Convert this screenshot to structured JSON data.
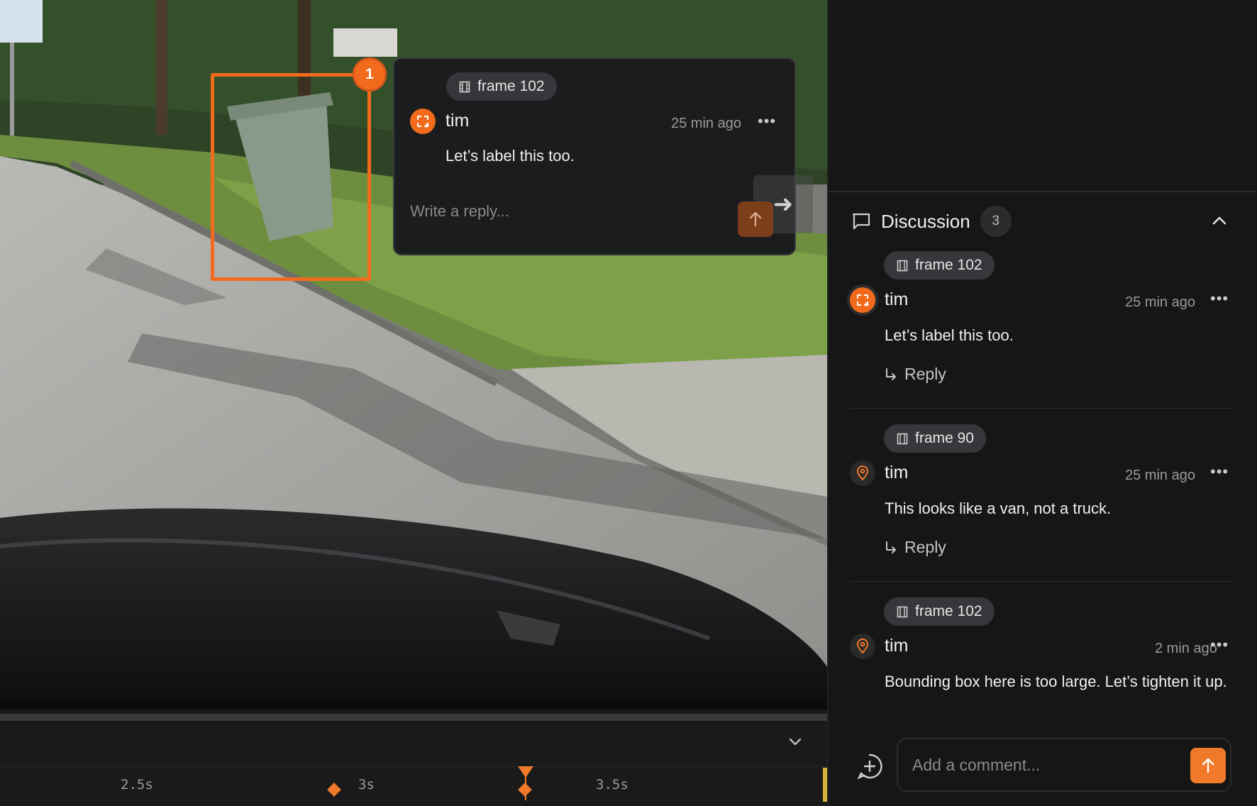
{
  "annotation": {
    "badge_number": "1",
    "accent": "#f26b1d"
  },
  "popover": {
    "frame_label": "frame 102",
    "author": "tim",
    "time": "25 min ago",
    "more": "•••",
    "text": "Let’s label this too.",
    "reply_placeholder": "Write a reply..."
  },
  "timeline": {
    "ticks": [
      "2.5s",
      "3s",
      "3.5s"
    ]
  },
  "discussion": {
    "title": "Discussion",
    "count": "3",
    "reply_label": "Reply",
    "comments": [
      {
        "frame_label": "frame 102",
        "author": "tim",
        "time": "25 min ago",
        "more": "•••",
        "text": "Let’s label this too.",
        "avatar": "bbox-icon"
      },
      {
        "frame_label": "frame 90",
        "author": "tim",
        "time": "25 min ago",
        "more": "•••",
        "text": "This looks like a van, not a truck.",
        "avatar": "pin-icon"
      },
      {
        "frame_label": "frame 102",
        "author": "tim",
        "time": "2 min ago",
        "more": "•••",
        "text": "Bounding box here is too large. Let’s tighten it up.",
        "avatar": "pin-icon"
      }
    ],
    "add_placeholder": "Add a comment..."
  }
}
